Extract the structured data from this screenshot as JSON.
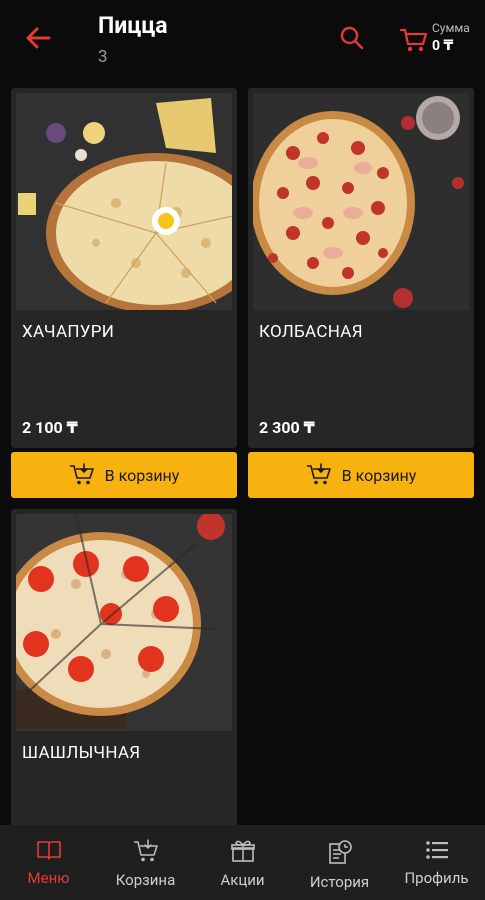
{
  "header": {
    "title": "Пицца",
    "count": "3",
    "sum_label": "Сумма",
    "sum_value": "0 ₸"
  },
  "products": [
    {
      "name": "ХАЧАПУРИ",
      "price": "2 100 ₸",
      "button": "В корзину"
    },
    {
      "name": "КОЛБАСНАЯ",
      "price": "2 300 ₸",
      "button": "В корзину"
    },
    {
      "name": "ШАШЛЫЧНАЯ",
      "price": "",
      "button": ""
    }
  ],
  "nav": {
    "items": [
      {
        "label": "Меню",
        "icon": "book-icon",
        "active": true
      },
      {
        "label": "Корзина",
        "icon": "cart-icon",
        "active": false
      },
      {
        "label": "Акции",
        "icon": "gift-icon",
        "active": false
      },
      {
        "label": "История",
        "icon": "history-icon",
        "active": false
      },
      {
        "label": "Профиль",
        "icon": "list-icon",
        "active": false
      }
    ]
  },
  "colors": {
    "accent": "#e53935",
    "button": "#f7b20f",
    "card": "#262626",
    "background": "#0b0b0b"
  }
}
